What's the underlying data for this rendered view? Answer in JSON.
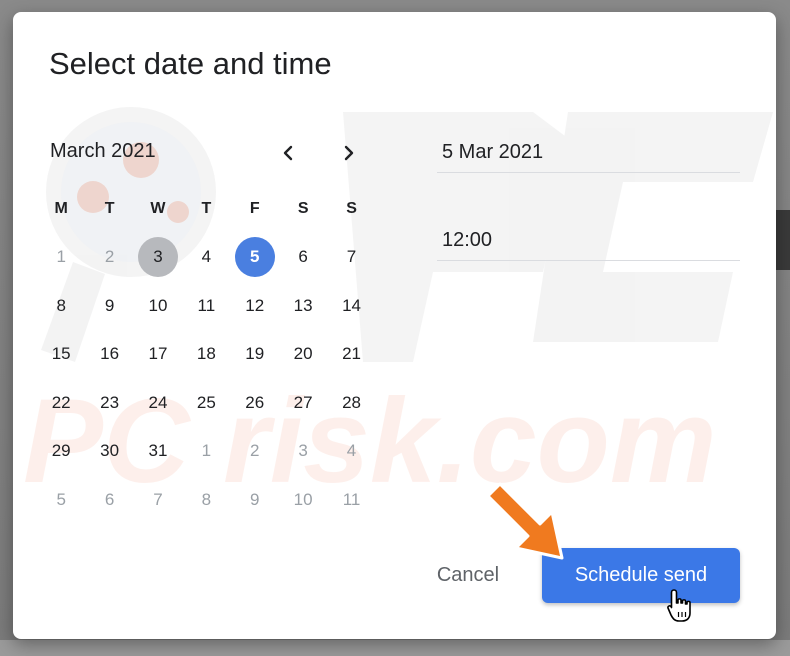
{
  "dialog": {
    "title": "Select date and time"
  },
  "calendar": {
    "month_label": "March 2021",
    "weekdays": [
      "M",
      "T",
      "W",
      "T",
      "F",
      "S",
      "S"
    ],
    "weeks": [
      [
        {
          "d": "1",
          "muted": true
        },
        {
          "d": "2",
          "muted": true
        },
        {
          "d": "3",
          "state": "today"
        },
        {
          "d": "4"
        },
        {
          "d": "5",
          "state": "selected"
        },
        {
          "d": "6"
        },
        {
          "d": "7"
        }
      ],
      [
        {
          "d": "8"
        },
        {
          "d": "9"
        },
        {
          "d": "10"
        },
        {
          "d": "11"
        },
        {
          "d": "12"
        },
        {
          "d": "13"
        },
        {
          "d": "14"
        }
      ],
      [
        {
          "d": "15"
        },
        {
          "d": "16"
        },
        {
          "d": "17"
        },
        {
          "d": "18"
        },
        {
          "d": "19"
        },
        {
          "d": "20"
        },
        {
          "d": "21"
        }
      ],
      [
        {
          "d": "22"
        },
        {
          "d": "23"
        },
        {
          "d": "24"
        },
        {
          "d": "25"
        },
        {
          "d": "26"
        },
        {
          "d": "27"
        },
        {
          "d": "28"
        }
      ],
      [
        {
          "d": "29"
        },
        {
          "d": "30"
        },
        {
          "d": "31"
        },
        {
          "d": "1",
          "muted": true
        },
        {
          "d": "2",
          "muted": true
        },
        {
          "d": "3",
          "muted": true
        },
        {
          "d": "4",
          "muted": true
        }
      ],
      [
        {
          "d": "5",
          "muted": true
        },
        {
          "d": "6",
          "muted": true
        },
        {
          "d": "7",
          "muted": true
        },
        {
          "d": "8",
          "muted": true
        },
        {
          "d": "9",
          "muted": true
        },
        {
          "d": "10",
          "muted": true
        },
        {
          "d": "11",
          "muted": true
        }
      ]
    ],
    "prev_icon": "chevron-left-icon",
    "next_icon": "chevron-right-icon"
  },
  "fields": {
    "date_value": "5 Mar 2021",
    "time_value": "12:00"
  },
  "actions": {
    "cancel_label": "Cancel",
    "schedule_label": "Schedule send"
  },
  "colors": {
    "accent": "#3b78e7",
    "selected_day": "#4a7fe0",
    "today_day": "#b7b9bd",
    "annotation_arrow": "#f07a1f"
  },
  "watermark": {
    "text": "PC risk.com"
  }
}
